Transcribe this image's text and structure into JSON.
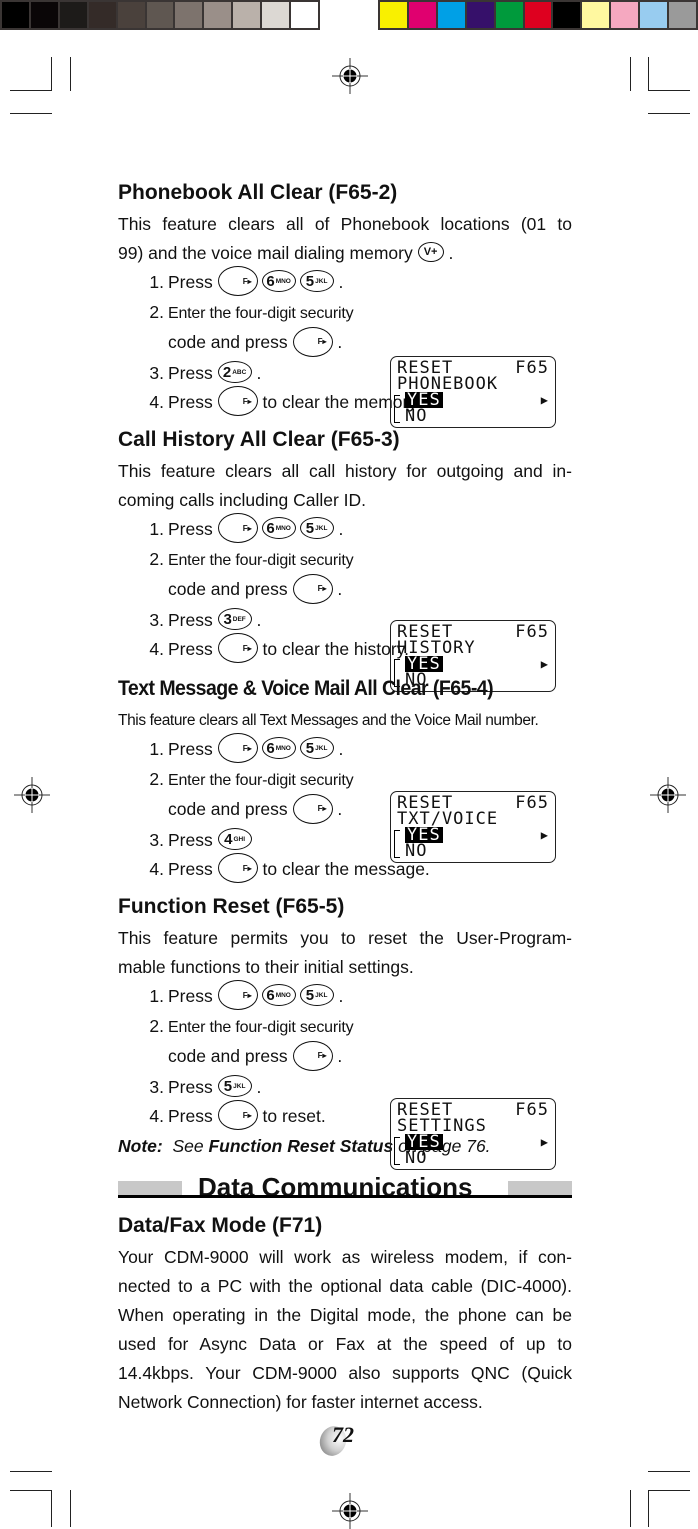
{
  "print_marks": {
    "left_swatches": [
      "#000000",
      "#0a0607",
      "#1d1b19",
      "#342b28",
      "#4a413c",
      "#5f5751",
      "#7d736d",
      "#9a8f89",
      "#bab1aa",
      "#dcd8d3",
      "#ffffff"
    ],
    "right_swatches": [
      "#f9f000",
      "#e0006f",
      "#00a0e6",
      "#36106a",
      "#009a3c",
      "#de001f",
      "#000000",
      "#fff8a0",
      "#f5a8c0",
      "#98ccf0",
      "#9a9a9a"
    ]
  },
  "sections": [
    {
      "title": "Phonebook All Clear (F65-2)",
      "description": [
        "This feature clears all of Phonebook locations (01 to",
        "99) and the voice mail dialing memory"
      ],
      "description_key": "V+",
      "steps": {
        "s1_prefix": "Press",
        "s2_text": "Enter the four-digit security",
        "s2_cont": "code and press",
        "s3_prefix": "Press",
        "s3_key": {
          "digit": "2",
          "letters": "ABC"
        },
        "s4_prefix": "Press",
        "s4_suffix": "to clear the memory."
      },
      "lcd": {
        "line1_left": "RESET",
        "line1_right": "F65",
        "line2": "PHONEBOOK",
        "selected": "YES",
        "option2": "NO"
      }
    },
    {
      "title": "Call History All Clear (F65-3)",
      "description": [
        "This feature clears all call history for outgoing and in-",
        "coming calls including Caller ID."
      ],
      "steps": {
        "s1_prefix": "Press",
        "s2_text": "Enter the four-digit security",
        "s2_cont": "code  and press",
        "s3_prefix": "Press",
        "s3_key": {
          "digit": "3",
          "letters": "DEF"
        },
        "s4_prefix": "Press",
        "s4_suffix": "to clear the history."
      },
      "lcd": {
        "line1_left": "RESET",
        "line1_right": "F65",
        "line2": "HISTORY",
        "selected": "YES",
        "option2": "NO"
      }
    },
    {
      "title": "Text Message & Voice Mail All Clear (F65-4)",
      "description": [
        "This feature clears all Text Messages and the Voice Mail number."
      ],
      "steps": {
        "s1_prefix": "Press",
        "s2_text": "Enter the four-digit security",
        "s2_cont": "code and press",
        "s3_prefix": "Press",
        "s3_key": {
          "digit": "4",
          "letters": "GHI"
        },
        "s4_prefix": "Press",
        "s4_suffix": "to clear the message."
      },
      "lcd": {
        "line1_left": "RESET",
        "line1_right": "F65",
        "line2": "TXT/VOICE",
        "selected": "YES",
        "option2": "NO"
      }
    },
    {
      "title": "Function Reset (F65-5)",
      "description": [
        "This feature permits you to reset the User-Program-",
        "mable functions to their initial settings."
      ],
      "steps": {
        "s1_prefix": "Press",
        "s2_text": "Enter the four-digit security",
        "s2_cont": "code and press",
        "s3_prefix": "Press",
        "s3_key": {
          "digit": "5",
          "letters": "JKL"
        },
        "s4_prefix": "Press",
        "s4_suffix": "to reset."
      },
      "lcd": {
        "line1_left": "RESET",
        "line1_right": "F65",
        "line2": "SETTINGS",
        "selected": "YES",
        "option2": "NO"
      },
      "note": {
        "label": "Note:",
        "pre": "See",
        "ref": "Function Reset Status",
        "post": "on page 76."
      }
    }
  ],
  "step_numbers": [
    "1.",
    "2.",
    "3.",
    "4."
  ],
  "keys": {
    "function": "F▸",
    "six": {
      "digit": "6",
      "letters": "MNO"
    },
    "five": {
      "digit": "5",
      "letters": "JKL"
    }
  },
  "banner": {
    "title": "Data Communications"
  },
  "data_fax": {
    "title": "Data/Fax Mode (F71)",
    "paragraph": [
      "Your CDM-9000 will work as wireless modem, if con-",
      "nected to a PC with the optional data cable (DIC-4000).",
      "When operating in the Digital mode, the phone can be",
      "used for Async Data or Fax at the speed of up to",
      "14.4kbps. Your CDM-9000 also supports QNC (Quick",
      "Network Connection) for faster internet access."
    ]
  },
  "page_number": "72"
}
